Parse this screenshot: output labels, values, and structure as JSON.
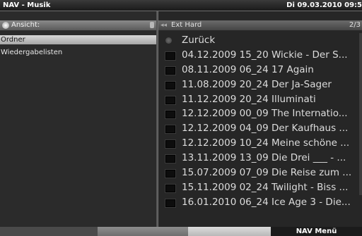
{
  "titlebar": {
    "app_title": "NAV - Musik",
    "datetime": "Di 09.03.2010 09:5"
  },
  "left": {
    "view_label": "Ansicht:",
    "items": [
      {
        "label": "Ordner",
        "selected": true
      },
      {
        "label": "Wiedergabelisten",
        "selected": false
      }
    ]
  },
  "right": {
    "path": "Ext Hard",
    "page": "2/3",
    "rows": [
      {
        "label": "Zurück",
        "icon": "back-icon"
      },
      {
        "label": "04.12.2009 15_20 Wickie - Der S...",
        "icon": "folder-icon"
      },
      {
        "label": "08.11.2009 06_24 17 Again",
        "icon": "folder-icon"
      },
      {
        "label": "11.08.2009 20_24 Der Ja-Sager",
        "icon": "folder-icon"
      },
      {
        "label": "11.12.2009 20_24 Illuminati",
        "icon": "folder-icon"
      },
      {
        "label": "12.12.2009 00_09 The Internatio...",
        "icon": "folder-icon"
      },
      {
        "label": "12.12.2009 04_09 Der Kaufhaus ...",
        "icon": "folder-icon"
      },
      {
        "label": "12.12.2009 10_24 Meine schöne ...",
        "icon": "folder-icon"
      },
      {
        "label": "13.11.2009 13_09 Die Drei ___ - ...",
        "icon": "folder-icon"
      },
      {
        "label": "15.07.2009 07_09 Die Reise zum ...",
        "icon": "folder-icon"
      },
      {
        "label": "15.11.2009 02_24 Twilight - Biss ...",
        "icon": "folder-icon"
      },
      {
        "label": "16.01.2010 06_24 Ice Age 3 - Die...",
        "icon": "folder-icon"
      }
    ]
  },
  "bottombar": {
    "nav_menu_label": "NAV Menü"
  }
}
